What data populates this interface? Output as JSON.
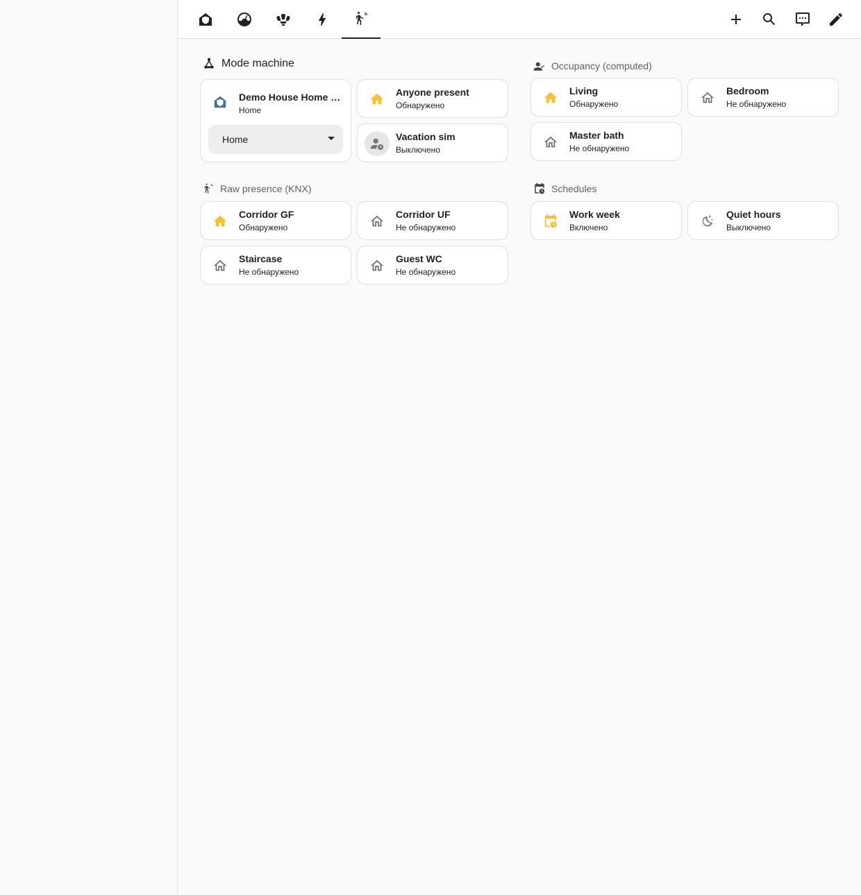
{
  "colors": {
    "active": "#fbc02d",
    "inactive": "#757575",
    "mode": "#44739e"
  },
  "topbar": {
    "tabs": [
      {
        "icon": "home-shield-icon",
        "active": false
      },
      {
        "icon": "gauge-icon",
        "active": false
      },
      {
        "icon": "chandelier-icon",
        "active": false
      },
      {
        "icon": "lightning-bolt-icon",
        "active": false
      },
      {
        "icon": "motion-sensor-icon",
        "active": true
      }
    ],
    "actions": [
      "plus-icon",
      "magnify-icon",
      "message-icon",
      "pencil-icon"
    ]
  },
  "sections": {
    "mode_machine": {
      "title": "Mode machine",
      "select_card": {
        "name": "Demo House Home mode",
        "state": "Home",
        "selected": "Home"
      },
      "anyone_present": {
        "name": "Anyone present",
        "state": "Обнаружено"
      },
      "vacation_sim": {
        "name": "Vacation sim",
        "state": "Выключено"
      }
    },
    "occupancy": {
      "title": "Occupancy (computed)",
      "items": [
        {
          "name": "Living",
          "state": "Обнаружено"
        },
        {
          "name": "Bedroom",
          "state": "Не обнаружено"
        },
        {
          "name": "Master bath",
          "state": "Не обнаружено"
        }
      ]
    },
    "raw_presence": {
      "title": "Raw presence (KNX)",
      "items": [
        {
          "name": "Corridor GF",
          "state": "Обнаружено"
        },
        {
          "name": "Corridor UF",
          "state": "Не обнаружено"
        },
        {
          "name": "Staircase",
          "state": "Не обнаружено"
        },
        {
          "name": "Guest WC",
          "state": "Не обнаружено"
        }
      ]
    },
    "schedules": {
      "title": "Schedules",
      "items": [
        {
          "name": "Work week",
          "state": "Включено"
        },
        {
          "name": "Quiet hours",
          "state": "Выключено"
        }
      ]
    }
  }
}
